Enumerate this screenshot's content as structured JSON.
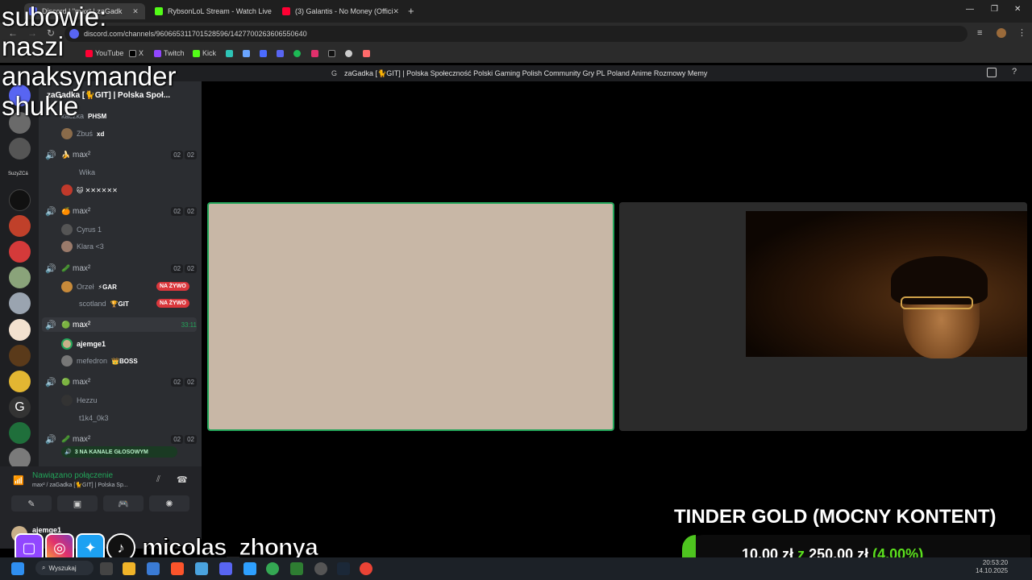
{
  "overlay": {
    "subs_lines": [
      "subowie:",
      "naszi",
      "anaksymander",
      "shukie"
    ]
  },
  "browser": {
    "tabs": [
      "Discord | \"max² | zaGadk",
      "RybsonLoL Stream - Watch Live",
      "(3) Galantis - No Money (Offici"
    ],
    "url": "discord.com/channels/960665311701528596/1427700263606550640",
    "bookmarks": [
      "YouTube",
      "X",
      "Twitch",
      "Kick"
    ]
  },
  "discord": {
    "server_header": "zaGadka [🐈GIT] | Polska Społeczność Polski Gaming Polish Community Gry PL Poland Anime Rozmowy Memy",
    "server_name": "zaGadka [🐈GIT] | Polska Społ...",
    "top_members": [
      {
        "name": "kaczka",
        "tag": "PHSM"
      },
      {
        "name": "Zbuś",
        "tag": "xd"
      }
    ],
    "channels": [
      {
        "name": "max²",
        "emoji": "🍌",
        "c1": "02",
        "c2": "02",
        "members": [
          {
            "name": "Wika"
          },
          {
            "name": "",
            "tag": "🐱 ✕✕✕✕✕✕"
          }
        ]
      },
      {
        "name": "max²",
        "emoji": "🍊",
        "c1": "02",
        "c2": "02",
        "members": [
          {
            "name": "Cyrus 1"
          },
          {
            "name": "Klara <3"
          }
        ]
      },
      {
        "name": "max²",
        "emoji": "🥒",
        "c1": "02",
        "c2": "02",
        "members": [
          {
            "name": "Orzeł",
            "tag": "⚡GAR",
            "live": "NA ŻYWO"
          },
          {
            "name": "scotland",
            "tag": "🏆GIT",
            "live": "NA ŻYWO"
          }
        ]
      },
      {
        "name": "max²",
        "emoji": "🟢",
        "timer": "33:11",
        "members": [
          {
            "name": "ajemge1"
          },
          {
            "name": "mefedron",
            "tag": "👑BOSS"
          }
        ]
      },
      {
        "name": "max²",
        "emoji": "🟢",
        "c1": "02",
        "c2": "02",
        "members": [
          {
            "name": "Hezzu"
          },
          {
            "name": "t1k4_0k3"
          }
        ]
      },
      {
        "name": "max²",
        "emoji": "🥒",
        "c1": "02",
        "c2": "02",
        "members": []
      }
    ],
    "voice_badge": "3 NA KANALE GŁOSOWYM",
    "connection": {
      "status": "Nawiązano połączenie",
      "channel": "max² / zaGadka [🐈GIT] | Polska Sp..."
    },
    "user": "ajemge1",
    "server_rail_label": "SuzyZCá"
  },
  "goal": {
    "title": "TINDER GOLD (MOCNY KONTENT)",
    "current": "10,00 zł",
    "sep": "z",
    "target": "250,00 zł",
    "percent": "(4.00%)",
    "progress": 0.04
  },
  "social": {
    "handle": "micolas_zhonya"
  },
  "taskbar": {
    "search": "Wyszukaj",
    "time": "20:53:20",
    "date": "14.10.2025"
  },
  "colors": {
    "accent_green": "#23a55a",
    "live_red": "#da373c",
    "goal_green": "#5be01e"
  }
}
